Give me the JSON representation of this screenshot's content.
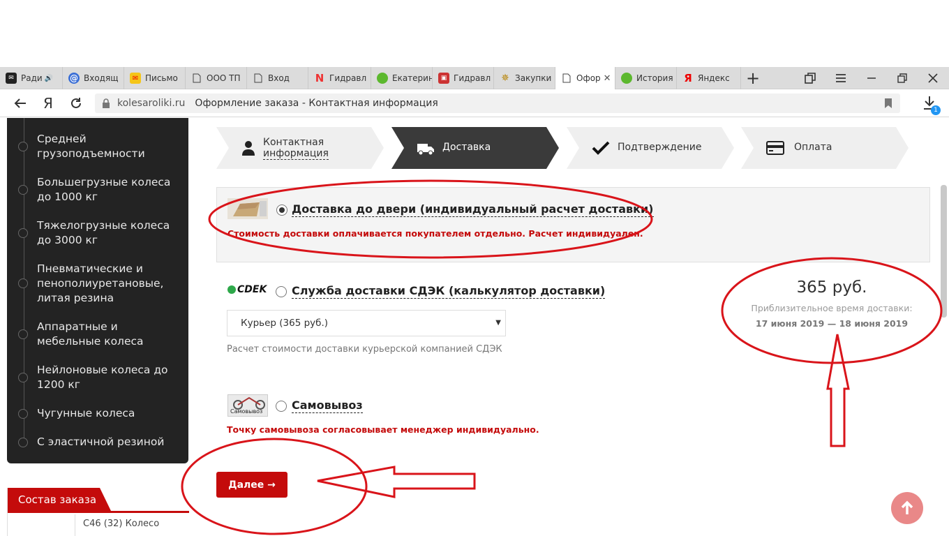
{
  "browser": {
    "tabs": [
      {
        "label": "Ради",
        "icon": "mail-icon",
        "active": false
      },
      {
        "label": "Входящ",
        "icon": "at-icon",
        "active": false
      },
      {
        "label": "Письмо",
        "icon": "yandex-mail-icon",
        "active": false
      },
      {
        "label": "ООО ТП",
        "icon": "page-icon",
        "active": false
      },
      {
        "label": "Вход",
        "icon": "page-icon",
        "active": false
      },
      {
        "label": "Гидравл",
        "icon": "n-logo-icon",
        "active": false
      },
      {
        "label": "Екатерин",
        "icon": "green-leaf-icon",
        "active": false
      },
      {
        "label": "Гидравл",
        "icon": "forklift-icon",
        "active": false
      },
      {
        "label": "Закупки",
        "icon": "emblem-icon",
        "active": false
      },
      {
        "label": "Офор",
        "icon": "page-icon",
        "active": true
      },
      {
        "label": "История",
        "icon": "green-leaf-icon",
        "active": false
      },
      {
        "label": "Яндекс",
        "icon": "yandex-icon",
        "active": false
      }
    ],
    "address": {
      "domain": "kolesaroliki.ru",
      "title": "Оформление заказа - Контактная информация"
    },
    "downloads_badge": "1"
  },
  "sidebar": {
    "items": [
      {
        "label": "Средней\nгрузоподъемности"
      },
      {
        "label": "Большегрузные колеса\nдо 1000 кг"
      },
      {
        "label": "Тяжелогрузные колеса\nдо 3000 кг"
      },
      {
        "label": "Пневматические и\nпенополиуретановые,\nлитая резина"
      },
      {
        "label": "Аппаратные и\nмебельные колеса"
      },
      {
        "label": "Нейлоновые колеса до\n1200 кг"
      },
      {
        "label": "Чугунные колеса"
      },
      {
        "label": "С эластичной резиной"
      }
    ]
  },
  "order": {
    "title": "Состав заказа",
    "item": "С46 (32) Колесо"
  },
  "steps": [
    {
      "label": "Контактная\nинформация",
      "icon": "user-icon",
      "active": false
    },
    {
      "label": "Доставка",
      "icon": "truck-icon",
      "active": true
    },
    {
      "label": "Подтверждение",
      "icon": "checkmark-icon",
      "active": false
    },
    {
      "label": "Оплата",
      "icon": "credit-card-icon",
      "active": false
    }
  ],
  "delivery": {
    "door": {
      "label": "Доставка до двери (индивидуальный расчет доставки)",
      "note": "Стоимость доставки оплачивается покупателем отдельно. Расчет индивидуален.",
      "selected": true
    },
    "cdek": {
      "logo": "CDEK",
      "label": "Служба доставки СДЭК (калькулятор доставки)",
      "select_value": "Курьер (365 руб.)",
      "note": "Расчет стоимости доставки курьерской компанией СДЭК",
      "price": "365 руб.",
      "eta_label": "Приблизительное время доставки:",
      "eta_dates": "17 июня 2019 — 18 июня 2019",
      "selected": false
    },
    "pickup": {
      "thumb_caption": "Самовывоз",
      "label": "Самовывоз",
      "note": "Точку самовывоза согласовывает менеджер индивидуально.",
      "selected": false
    }
  },
  "next_button": "Далее →",
  "colors": {
    "accent": "#c40b0b",
    "sidebar": "#232323",
    "annotation": "#d9141a"
  }
}
